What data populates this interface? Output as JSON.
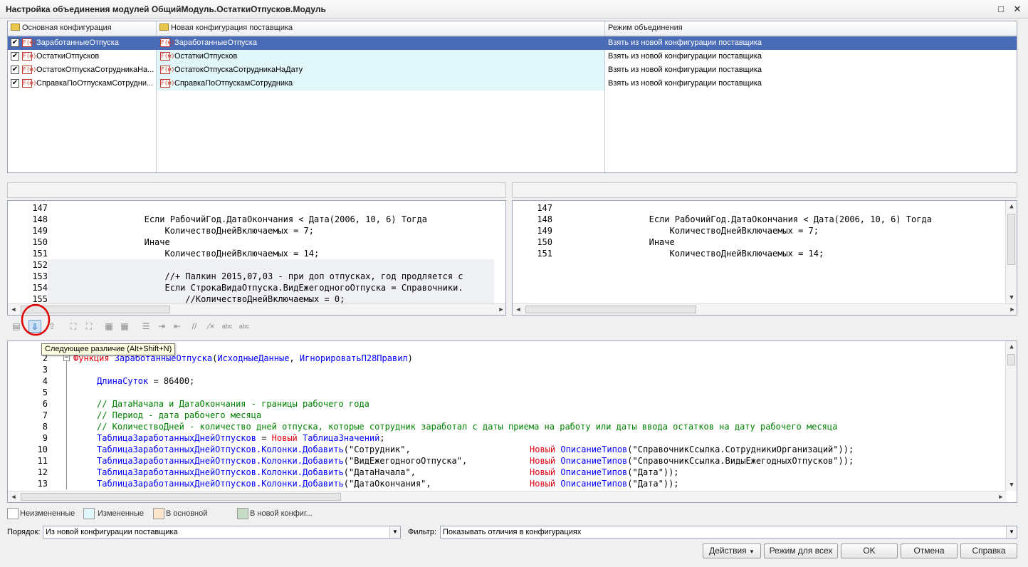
{
  "window": {
    "title": "Настройка объединения модулей ОбщийМодуль.ОстаткиОтпусков.Модуль",
    "maximize_icon": "□",
    "close_icon": "✕"
  },
  "top_table": {
    "headers": [
      "Основная конфигурация",
      "Новая конфигурация поставщика",
      "Режим объединения"
    ],
    "rows": [
      {
        "checked": true,
        "main": "ЗаработанныеОтпуска",
        "vendor": "ЗаработанныеОтпуска",
        "mode": "Взять из новой конфигурации поставщика",
        "selected": true
      },
      {
        "checked": true,
        "main": "ОстаткиОтпусков",
        "vendor": "ОстаткиОтпусков",
        "mode": "Взять из новой конфигурации поставщика",
        "selected": false
      },
      {
        "checked": true,
        "main": "ОстатокОтпускаСотрудникаНа...",
        "vendor": "ОстатокОтпускаСотрудникаНаДату",
        "mode": "Взять из новой конфигурации поставщика",
        "selected": false
      },
      {
        "checked": true,
        "main": "СправкаПоОтпускамСотрудни...",
        "vendor": "СправкаПоОтпускамСотрудника",
        "mode": "Взять из новой конфигурации поставщика",
        "selected": false
      }
    ],
    "module_icon_text": "F(м)"
  },
  "left_pane": {
    "lines": [
      {
        "n": "147",
        "t": ""
      },
      {
        "n": "148",
        "t": "                Если РабочийГод.ДатаОкончания < Дата(2006, 10, 6) Тогда"
      },
      {
        "n": "149",
        "t": "                    КоличествоДнейВключаемых = 7;"
      },
      {
        "n": "150",
        "t": "                Иначе"
      },
      {
        "n": "151",
        "t": "                    КоличествоДнейВключаемых = 14;"
      },
      {
        "n": "152",
        "t": ""
      },
      {
        "n": "153",
        "t": "                    //+ Палкин 2015,07,03 - при доп отпусках, год продляется с"
      },
      {
        "n": "154",
        "t": "                    Если СтрокаВидаОтпуска.ВидЕжегодногоОтпуска = Справочники."
      },
      {
        "n": "155",
        "t": "                        //КоличествоДнейВключаемых = 0;"
      }
    ]
  },
  "right_pane": {
    "lines": [
      {
        "n": "147",
        "t": ""
      },
      {
        "n": "148",
        "t": "                Если РабочийГод.ДатаОкончания < Дата(2006, 10, 6) Тогда"
      },
      {
        "n": "149",
        "t": "                    КоличествоДнейВключаемых = 7;"
      },
      {
        "n": "150",
        "t": "                Иначе"
      },
      {
        "n": "151",
        "t": "                    КоличествоДнейВключаемых = 14;"
      }
    ]
  },
  "toolbar": {
    "tooltip": "Следующее различие (Alt+Shift+N)"
  },
  "bottom_pane": {
    "line2": {
      "n": "2",
      "kw": "Функция ",
      "name": "ЗаработанныеОтпуска",
      "rest1": "(",
      "p1": "ИсходныеДанные",
      "sep": ", ",
      "p2": "ИгнорироватьП28Правил",
      "rest2": ")"
    },
    "line3": {
      "n": "3"
    },
    "line4": {
      "n": "4",
      "id": "ДлинаСуток",
      "rest": " = 86400;"
    },
    "line5": {
      "n": "5"
    },
    "line6": {
      "n": "6",
      "cm": "// ДатаНачала и ДатаОкончания - границы рабочего года"
    },
    "line7": {
      "n": "7",
      "cm": "// Период - дата рабочего месяца"
    },
    "line8": {
      "n": "8",
      "cm": "// КоличествоДней - количество дней отпуска, которые сотрудник заработал с даты приема на работу или даты ввода остатков на дату рабочего месяца"
    },
    "line9": {
      "n": "9",
      "id": "ТаблицаЗаработанныхДнейОтпусков",
      "eq": " = ",
      "kw": "Новый",
      "sp": " ",
      "id2": "ТаблицаЗначений",
      "end": ";"
    },
    "add_lines": [
      {
        "n": "10",
        "obj": "ТаблицаЗаработанныхДнейОтпусков",
        "m": ".Колонки.Добавить",
        "arg": "(\"Сотрудник\",",
        "kw": "Новый",
        "t": "ОписаниеТипов",
        "arg2": "(\"СправочникСсылка.СотрудникиОрганизаций\"));"
      },
      {
        "n": "11",
        "obj": "ТаблицаЗаработанныхДнейОтпусков",
        "m": ".Колонки.Добавить",
        "arg": "(\"ВидЕжегодногоОтпуска\",",
        "kw": "Новый",
        "t": "ОписаниеТипов",
        "arg2": "(\"СправочникСсылка.ВидыЕжегодныхОтпусков\"));"
      },
      {
        "n": "12",
        "obj": "ТаблицаЗаработанныхДнейОтпусков",
        "m": ".Колонки.Добавить",
        "arg": "(\"ДатаНачала\",",
        "kw": "Новый",
        "t": "ОписаниеТипов",
        "arg2": "(\"Дата\"));"
      },
      {
        "n": "13",
        "obj": "ТаблицаЗаработанныхДнейОтпусков",
        "m": ".Колонки.Добавить",
        "arg": "(\"ДатаОкончания\",",
        "kw": "Новый",
        "t": "ОписаниеТипов",
        "arg2": "(\"Дата\"));"
      }
    ]
  },
  "legend": [
    {
      "label": "Неизмененные",
      "color": "#ffffff"
    },
    {
      "label": "Измененные",
      "color": "#e0f6f8"
    },
    {
      "label": "В основной",
      "color": "#fde5cc"
    },
    {
      "label": "В новой конфиг...",
      "color": "#c6dcc6"
    }
  ],
  "order": {
    "label": "Порядок:",
    "value": "Из новой конфигурации поставщика"
  },
  "filter": {
    "label": "Фильтр:",
    "value": "Показывать отличия в конфигурациях"
  },
  "buttons": {
    "actions": "Действия",
    "mode_all": "Режим для всех",
    "ok": "OK",
    "cancel": "Отмена",
    "help": "Справка"
  },
  "colors": {
    "selection": "#4a6bb5",
    "changed_row": "#e0f6f8",
    "keyword": "#e0000e",
    "identifier": "#0000ff",
    "comment": "#008000",
    "highlight_circle": "#e00000"
  }
}
